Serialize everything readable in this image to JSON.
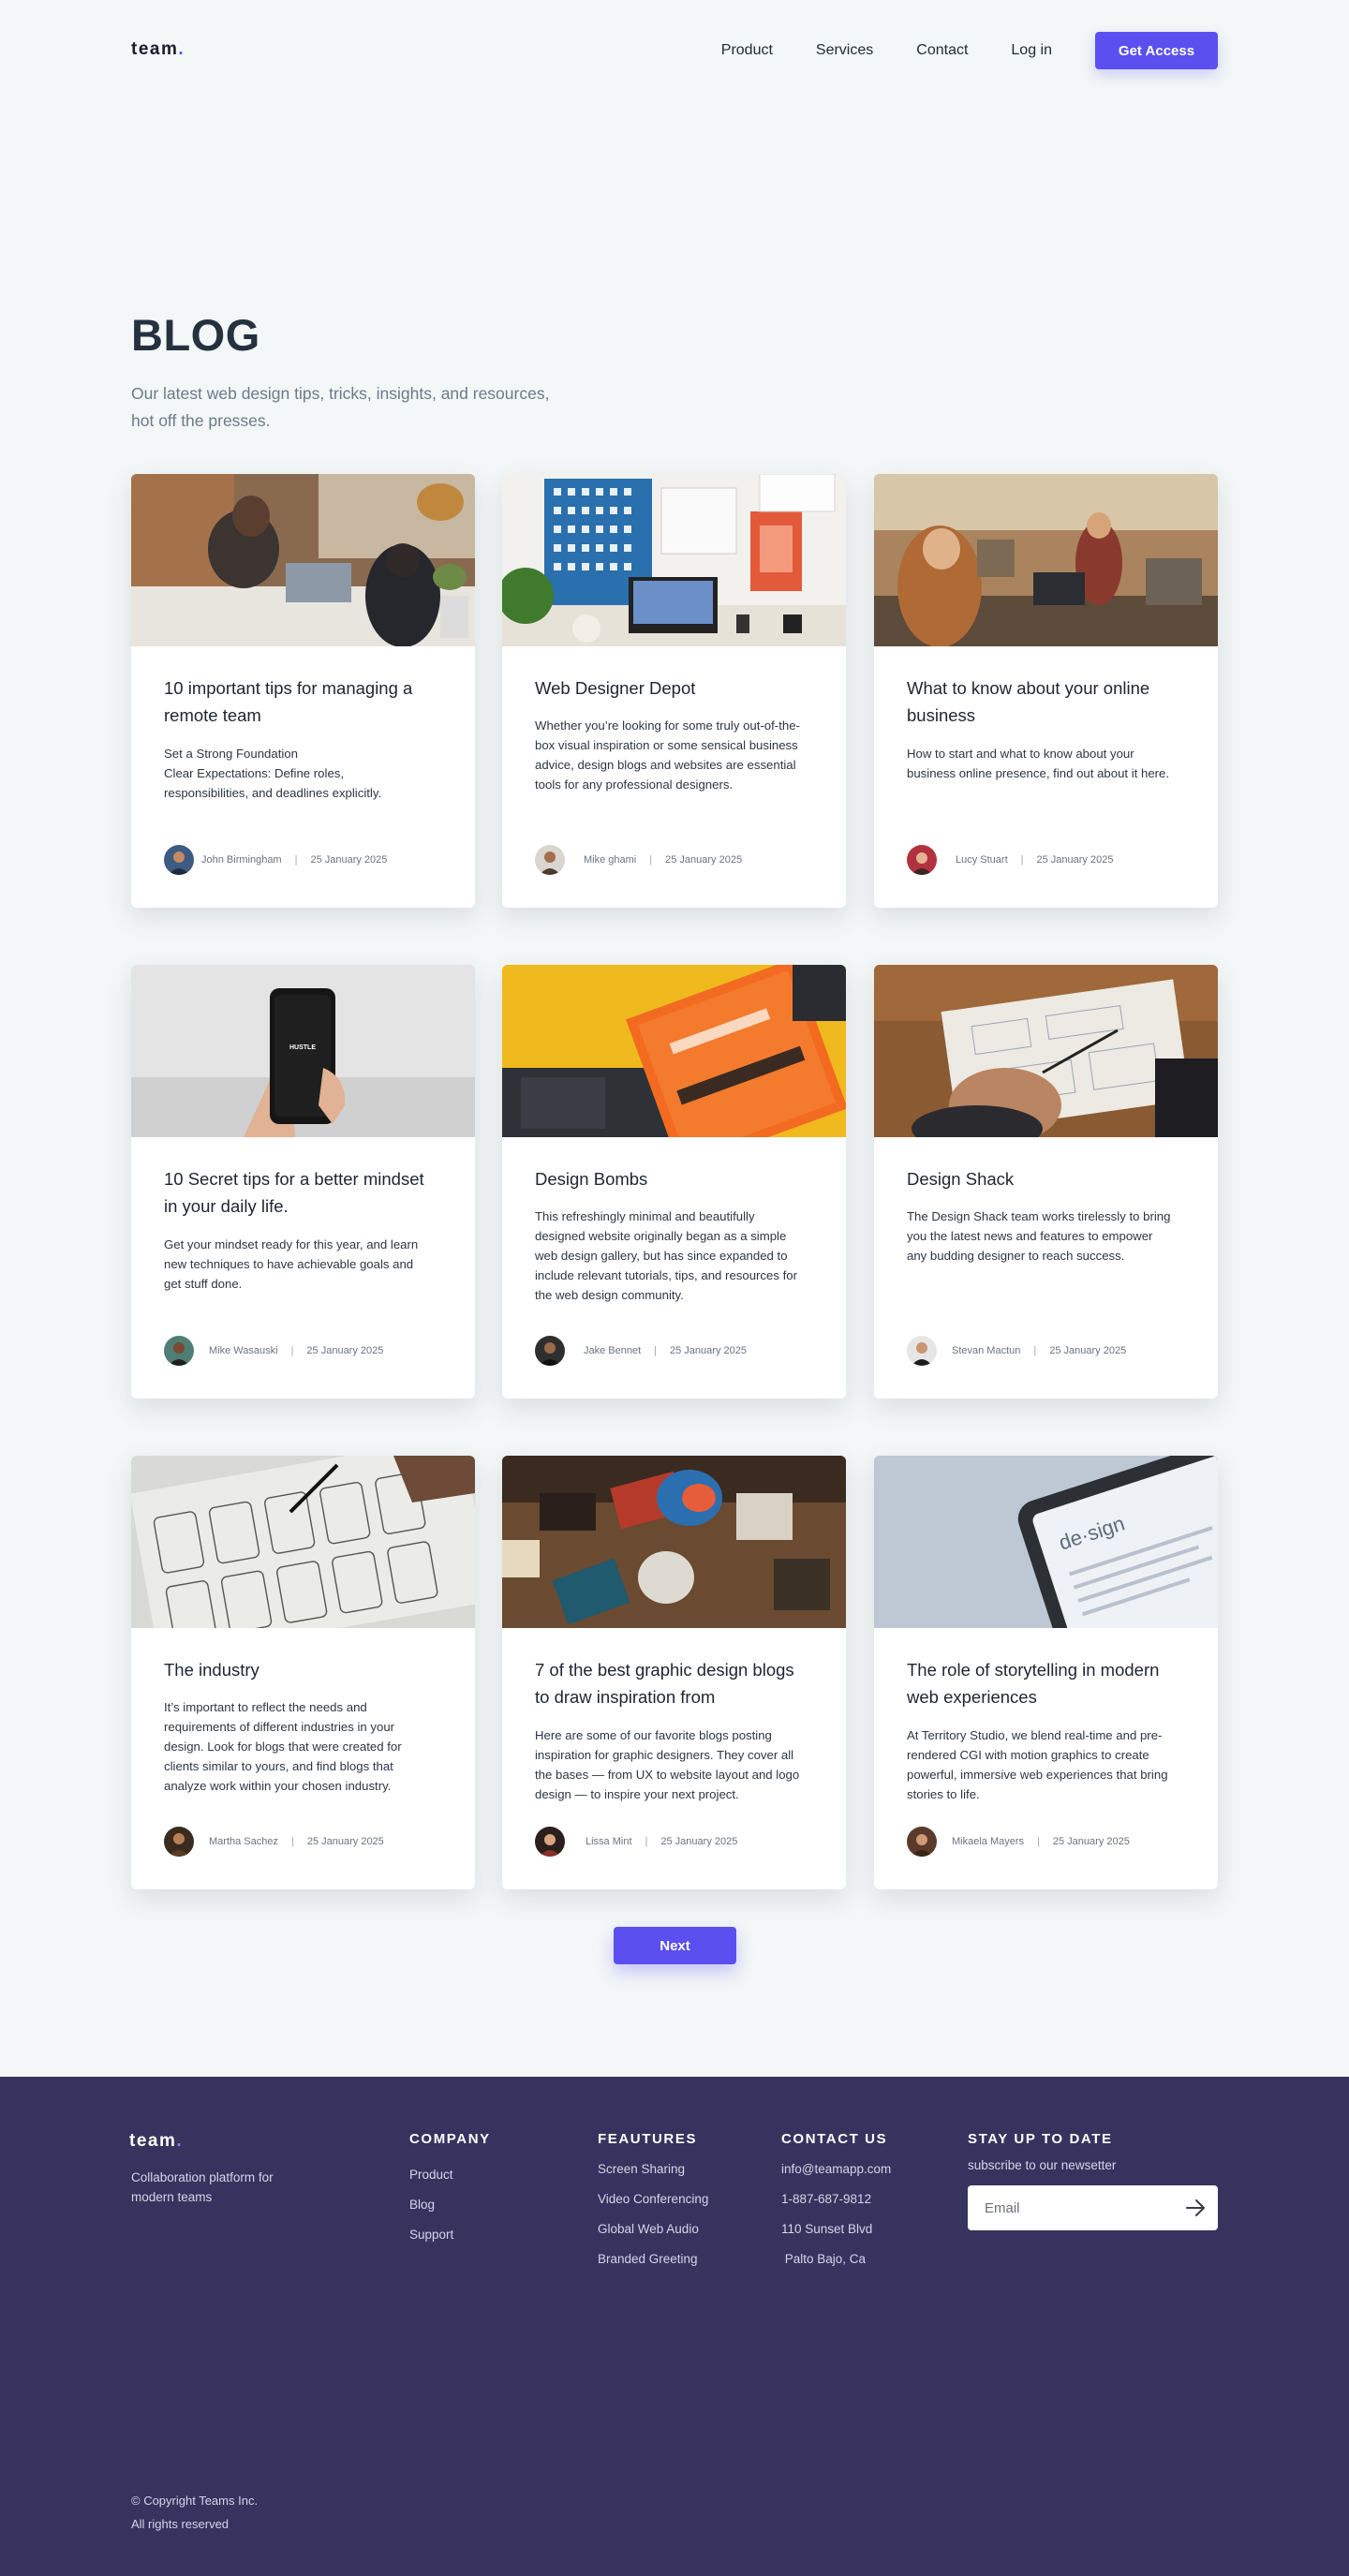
{
  "header": {
    "logo": "team",
    "logo_dot": ".",
    "nav": [
      "Product",
      "Services",
      "Contact",
      "Log in"
    ],
    "cta": "Get Access"
  },
  "hero": {
    "title": "BLOG",
    "subtitle": "Our latest web design tips, tricks, insights, and resources, hot off the presses."
  },
  "cards": [
    {
      "title": "10 important tips for managing a remote team",
      "excerpt": "Set a Strong Foundation\nClear Expectations: Define roles, responsibilities, and deadlines explicitly.",
      "author": "John Birmingham",
      "date": "25 January 2025",
      "image": "team meeting around laptops"
    },
    {
      "title": "Web Designer Depot",
      "excerpt": "Whether you’re looking for some truly out-of-the-box visual inspiration or some sensical business advice, design blogs and websites are essential tools for any professional designers.",
      "author": "Mike ghami",
      "date": "25 January 2025",
      "image": "designer desk with monitor and posters"
    },
    {
      "title": "What to know about your online business",
      "excerpt": "How to start and what to know about your business online presence, find out about it here.",
      "author": "Lucy Stuart",
      "date": "25 January 2025",
      "image": "people working in open office"
    },
    {
      "title": "10 Secret tips for a better mindset in your daily life.",
      "excerpt": "Get your mindset ready for this year, and learn new techniques to have achievable goals and get stuff done.",
      "author": "Mike Wasauski",
      "date": "25 January 2025",
      "image": "hand holding phone",
      "image_text": "HUSTLE"
    },
    {
      "title": "Design Bombs",
      "excerpt": "This refreshingly minimal and beautifully designed website originally began as a simple web design gallery, but has since expanded to include relevant tutorials, tips, and resources for the web design community.",
      "author": "Jake Bennet",
      "date": "25 January 2025",
      "image": "orange design book on yellow desk"
    },
    {
      "title": "Design Shack",
      "excerpt": "The Design Shack team works tirelessly to bring you the latest news and features to empower any budding designer to reach success.",
      "author": "Stevan Mactun",
      "date": "25 January 2025",
      "image": "hand sketching on paper"
    },
    {
      "title": "The industry",
      "excerpt": "It’s important to reflect the needs and requirements of different industries in your design. Look for blogs that were created for clients similar to yours, and find blogs that analyze work within your chosen industry.",
      "author": "Martha Sachez",
      "date": "25 January 2025",
      "image": "wireframe sketches"
    },
    {
      "title": "7 of the best graphic design blogs to draw inspiration from",
      "excerpt": "Here are some of our favorite blogs posting inspiration for graphic designers. They cover all the bases — from UX to website layout and logo design — to inspire your next project.",
      "author": "Lissa Mint",
      "date": "25 January 2025",
      "image": "printed graphic design materials"
    },
    {
      "title": "The role of storytelling in modern web experiences",
      "excerpt": "At Territory Studio, we blend real-time and pre-rendered CGI with motion graphics to create powerful, immersive web experiences that bring stories to life.",
      "author": "Mikaela Mayers",
      "date": "25 January 2025",
      "image": "phone showing design definition",
      "image_text": "de·sign"
    }
  ],
  "pager": {
    "next": "Next"
  },
  "footer": {
    "logo": "team",
    "logo_dot": ".",
    "tagline": "Collaboration platform for modern teams",
    "company": {
      "heading": "COMPANY",
      "links": [
        "Product",
        "Blog",
        "Support"
      ]
    },
    "features": {
      "heading": "FEAUTURES",
      "links": [
        "Screen Sharing",
        "Video Conferencing",
        "Global Web Audio",
        "Branded Greeting"
      ]
    },
    "contact": {
      "heading": "CONTACT US",
      "links": [
        "info@teamapp.com",
        "1-887-687-9812",
        "110 Sunset Blvd",
        " Palto Bajo, Ca"
      ]
    },
    "newsletter": {
      "heading": "STAY UP TO DATE",
      "subtitle": "subscribe to our newsetter",
      "placeholder": "Email",
      "submit_icon": "arrow-right-icon"
    },
    "copyright": "© Copyright Teams Inc.",
    "rights": "All rights reserved"
  },
  "colors": {
    "accent": "#5b4ff0",
    "page_bg": "#f3f7f7",
    "footer_bg": "#37325e"
  }
}
